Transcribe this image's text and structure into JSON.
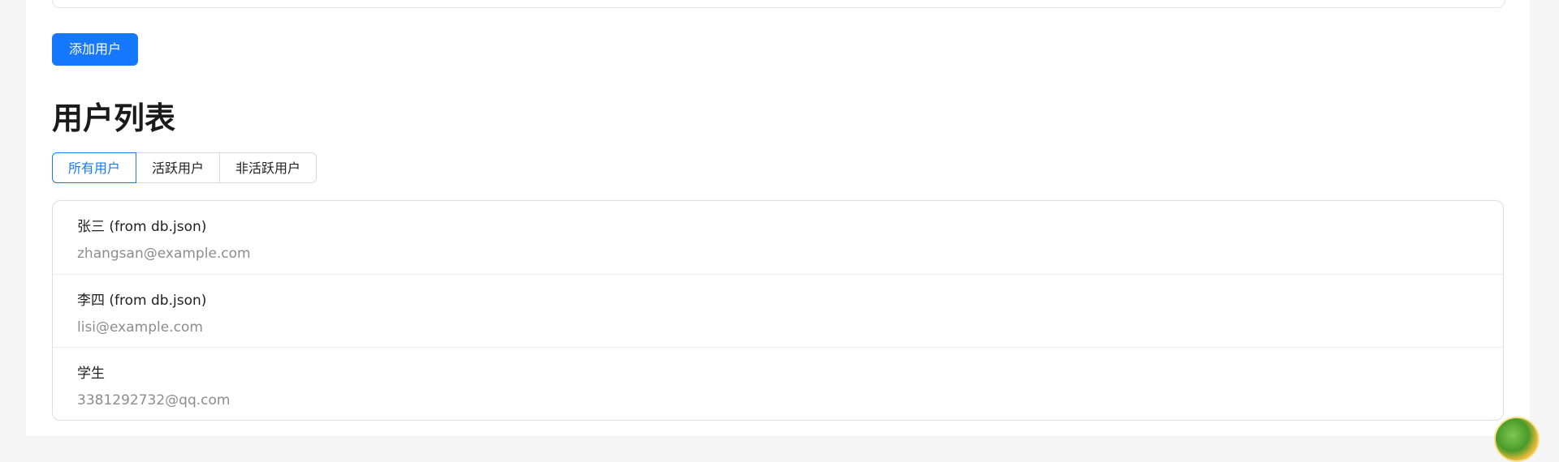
{
  "actions": {
    "add_user_label": "添加用户"
  },
  "user_section": {
    "title": "用户列表",
    "tabs": [
      {
        "label": "所有用户",
        "active": true
      },
      {
        "label": "活跃用户",
        "active": false
      },
      {
        "label": "非活跃用户",
        "active": false
      }
    ],
    "users": [
      {
        "name": "张三 (from db.json)",
        "email": "zhangsan@example.com"
      },
      {
        "name": "李四 (from db.json)",
        "email": "lisi@example.com"
      },
      {
        "name": "学生",
        "email": "3381292732@qq.com"
      }
    ]
  },
  "colors": {
    "primary": "#1677ff",
    "page_background": "#f5f5f5",
    "muted_text": "#8c8c8c"
  },
  "icons": {
    "floating_widget": "avatar-badge-icon"
  }
}
